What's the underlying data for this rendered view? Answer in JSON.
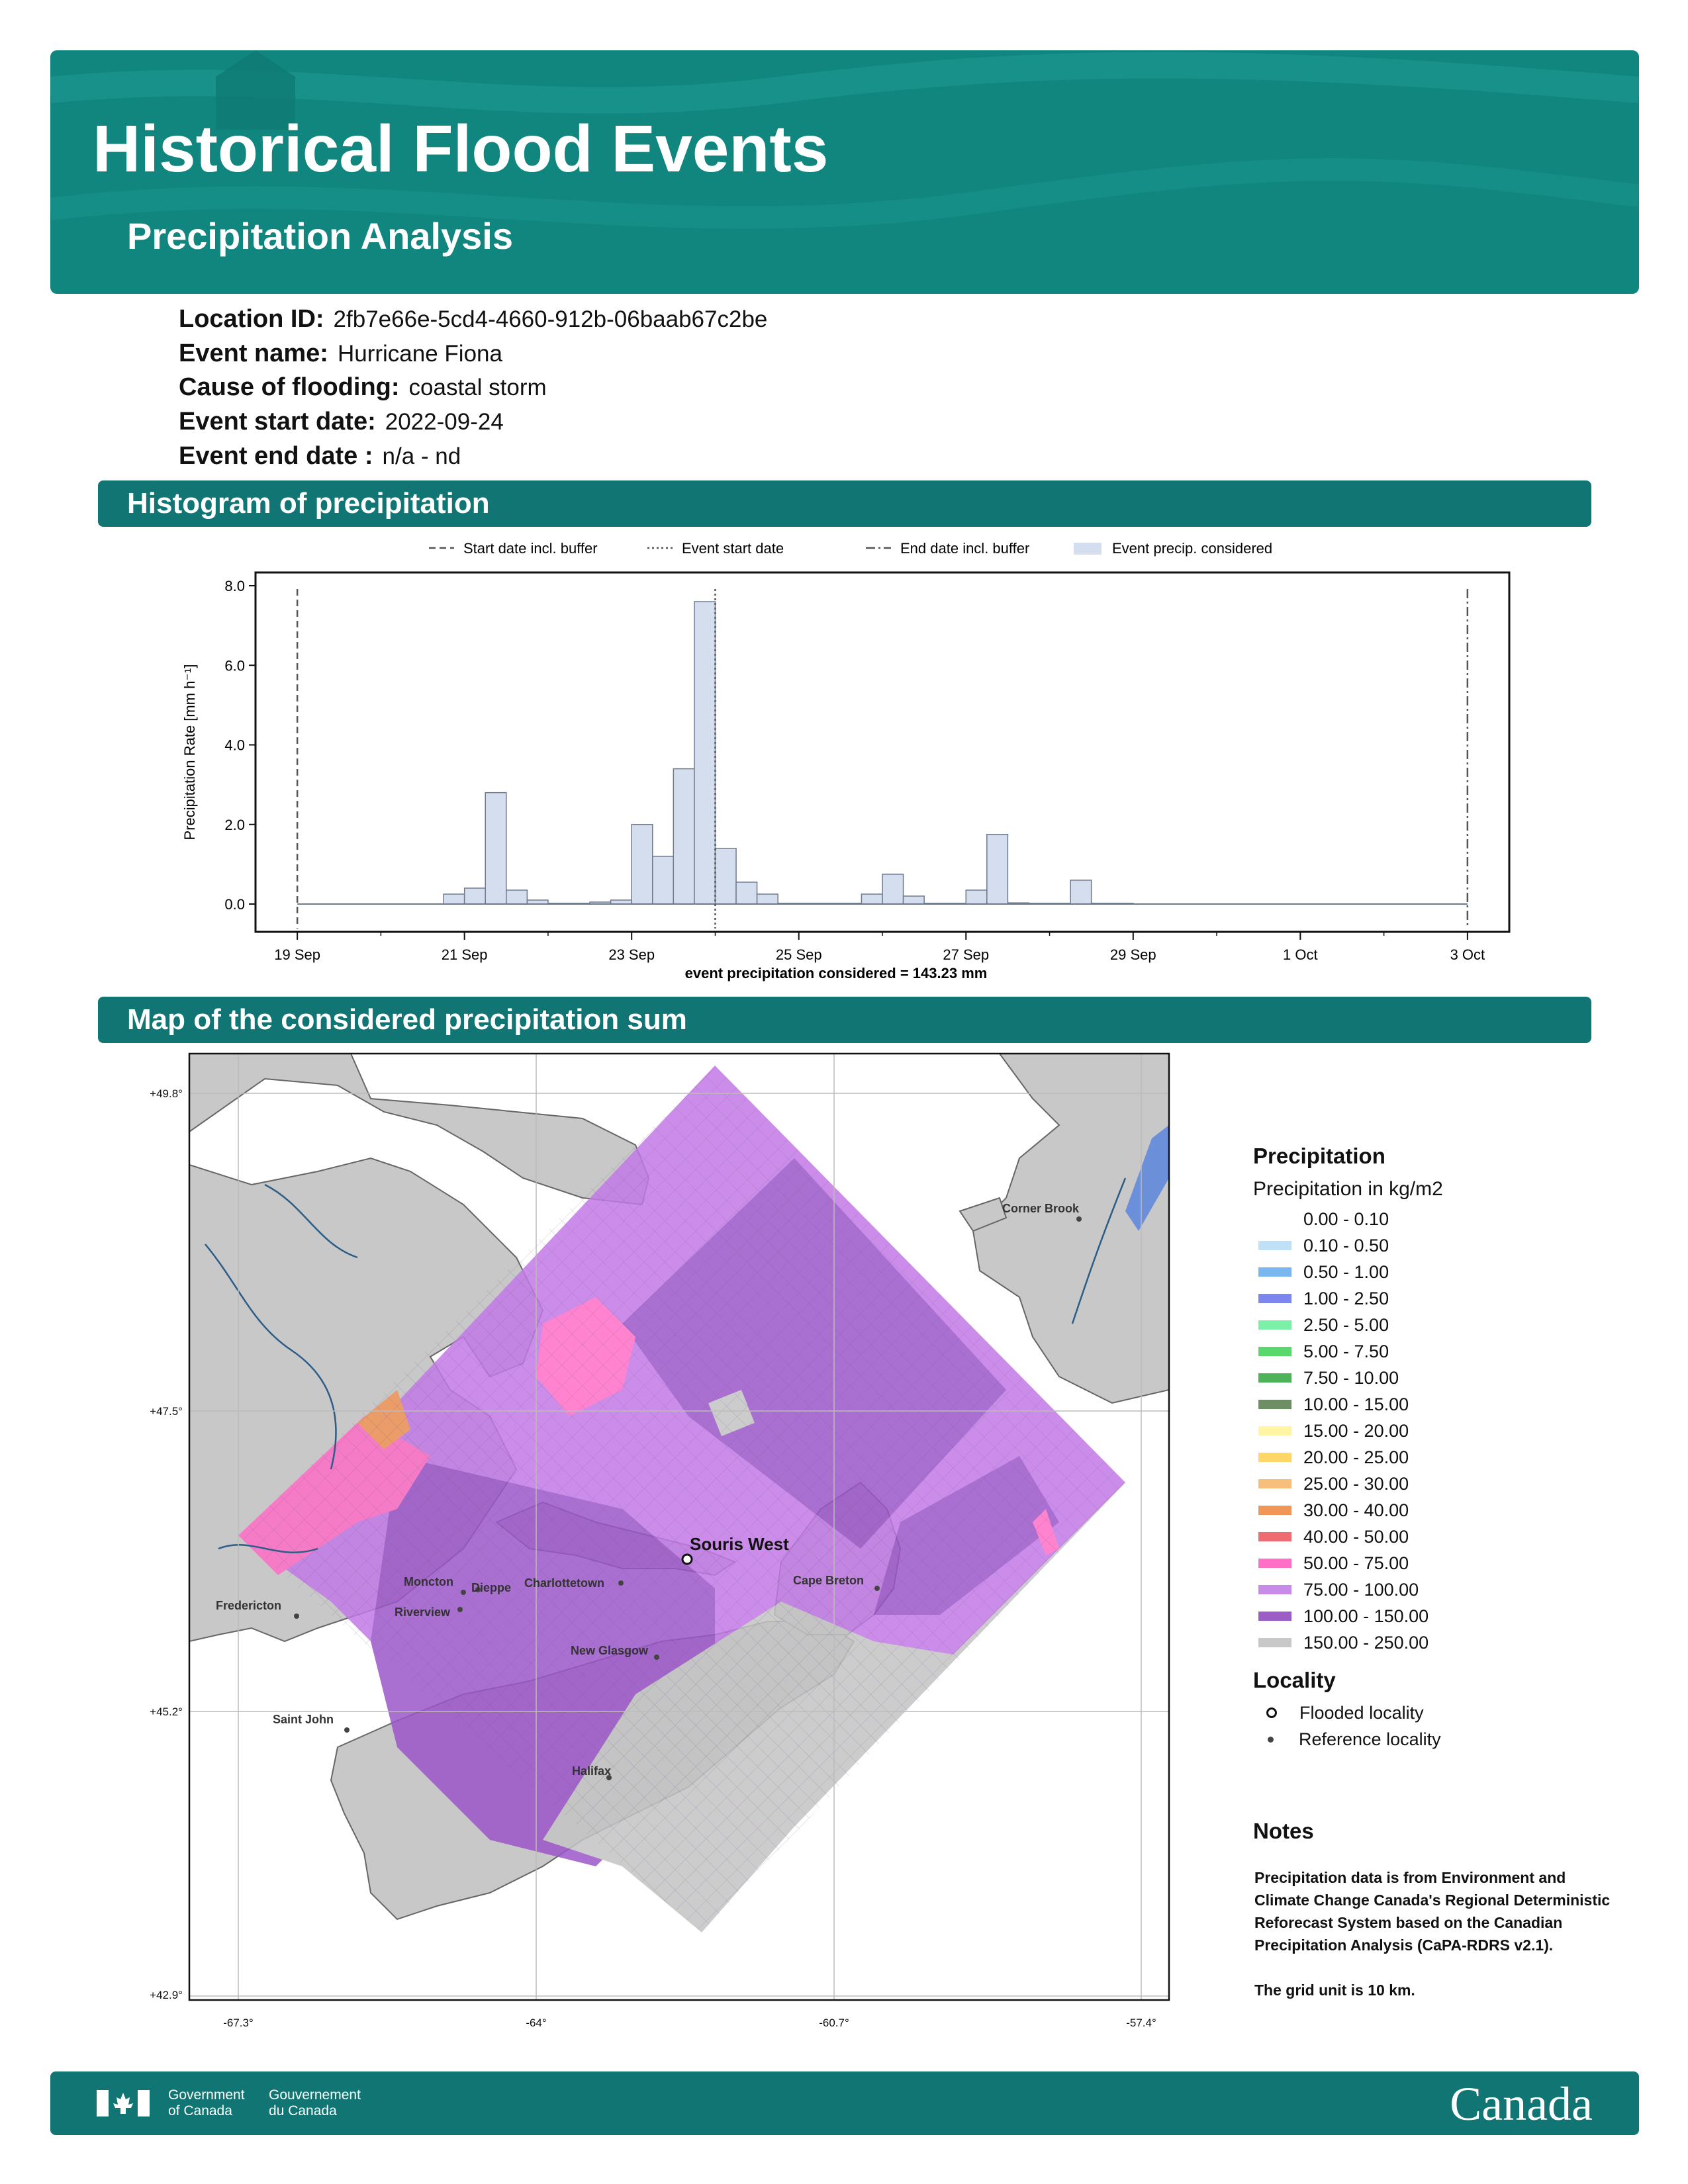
{
  "header": {
    "title": "Historical Flood Events",
    "subtitle": "Precipitation Analysis"
  },
  "meta": {
    "location_label": "Location ID:",
    "location_value": "2fb7e66e-5cd4-4660-912b-06baab67c2be",
    "event_name_label": "Event name:",
    "event_name_value": "Hurricane Fiona",
    "cause_label": "Cause of flooding:",
    "cause_value": "coastal storm",
    "start_label": "Event start date:",
    "start_value": "2022-09-24",
    "end_label": "Event end date :",
    "end_value": "n/a - nd"
  },
  "sections": {
    "histogram": "Histogram of precipitation",
    "map": "Map of the considered precipitation sum"
  },
  "chart_data": {
    "type": "bar",
    "title": "",
    "ylabel": "Precipitation Rate [mm h⁻¹]",
    "xlabel": "event precipitation considered = 143.23 mm",
    "ylim": [
      0,
      8.0
    ],
    "yticks": [
      "0.0",
      "2.0",
      "4.0",
      "6.0",
      "8.0"
    ],
    "xticks": [
      "19 Sep",
      "21 Sep",
      "23 Sep",
      "25 Sep",
      "27 Sep",
      "29 Sep",
      "1 Oct",
      "3 Oct"
    ],
    "bar_width_hours": 6,
    "legend": {
      "placement": "top",
      "entries": [
        "Start date incl. buffer",
        "Event start date",
        "End date incl. buffer",
        "Event precip. considered"
      ]
    },
    "markers": {
      "start_buffer": "2022-09-19T00:00",
      "event_start": "2022-09-24T00:00",
      "end_buffer": "2022-10-03T00:00"
    },
    "series": [
      {
        "name": "Event precip. considered",
        "x": [
          "2022-09-20T18:00",
          "2022-09-21T00:00",
          "2022-09-21T06:00",
          "2022-09-21T12:00",
          "2022-09-21T18:00",
          "2022-09-22T00:00",
          "2022-09-22T06:00",
          "2022-09-22T12:00",
          "2022-09-22T18:00",
          "2022-09-23T00:00",
          "2022-09-23T06:00",
          "2022-09-23T12:00",
          "2022-09-23T18:00",
          "2022-09-24T00:00",
          "2022-09-24T06:00",
          "2022-09-24T12:00",
          "2022-09-24T18:00",
          "2022-09-25T00:00",
          "2022-09-25T06:00",
          "2022-09-25T12:00",
          "2022-09-25T18:00",
          "2022-09-26T00:00",
          "2022-09-26T06:00",
          "2022-09-26T12:00",
          "2022-09-26T18:00",
          "2022-09-27T00:00",
          "2022-09-27T06:00",
          "2022-09-27T12:00",
          "2022-09-27T18:00",
          "2022-09-28T00:00",
          "2022-09-28T06:00",
          "2022-09-28T12:00",
          "2022-09-28T18:00"
        ],
        "values": [
          0.25,
          0.4,
          2.8,
          0.35,
          0.1,
          0.02,
          0.02,
          0.05,
          0.1,
          2.0,
          1.2,
          3.4,
          7.6,
          1.4,
          0.55,
          0.25,
          0.02,
          0.02,
          0.02,
          0.02,
          0.25,
          0.75,
          0.2,
          0.02,
          0.02,
          0.35,
          1.75,
          0.03,
          0.02,
          0.02,
          0.6,
          0.02,
          0.02
        ]
      }
    ]
  },
  "map": {
    "lat_labels": [
      "+49.8°",
      "+47.5°",
      "+45.2°",
      "+42.9°"
    ],
    "lon_labels": [
      "-67.3°",
      "-64°",
      "-60.7°",
      "-57.4°"
    ],
    "localities": {
      "flooded": "Souris West",
      "reference": [
        "Corner Brook",
        "Moncton",
        "Dieppe",
        "Charlottetown",
        "Fredericton",
        "Riverview",
        "Cape Breton",
        "New Glasgow",
        "Saint John",
        "Halifax"
      ]
    },
    "colors": {
      "land": "#c8c8c8",
      "purple_light": "#c27ae6",
      "purple_dark": "#9b56c9",
      "pink": "#ff6ec7",
      "grey_grid": "#c4c4c4"
    }
  },
  "legend": {
    "title": "Precipitation",
    "subtitle": "Precipitation in kg/m2",
    "classes": [
      {
        "label": "0.00 - 0.10",
        "color": "#ffffff"
      },
      {
        "label": "0.10 - 0.50",
        "color": "#bfe0f6"
      },
      {
        "label": "0.50 - 1.00",
        "color": "#7ab7f0"
      },
      {
        "label": "1.00 - 2.50",
        "color": "#7d86ec"
      },
      {
        "label": "2.50 - 5.00",
        "color": "#7cf0a8"
      },
      {
        "label": "5.00 - 7.50",
        "color": "#59d86e"
      },
      {
        "label": "7.50 - 10.00",
        "color": "#4cb35a"
      },
      {
        "label": "10.00 - 15.00",
        "color": "#6e8f64"
      },
      {
        "label": "15.00 - 20.00",
        "color": "#fff5a3"
      },
      {
        "label": "20.00 - 25.00",
        "color": "#ffd766"
      },
      {
        "label": "25.00 - 30.00",
        "color": "#f6c07c"
      },
      {
        "label": "30.00 - 40.00",
        "color": "#f19659"
      },
      {
        "label": "40.00 - 50.00",
        "color": "#ef6b72"
      },
      {
        "label": "50.00 - 75.00",
        "color": "#ff6ec7"
      },
      {
        "label": "75.00 - 100.00",
        "color": "#c98be8"
      },
      {
        "label": "100.00 - 150.00",
        "color": "#9b5ec5"
      },
      {
        "label": "150.00 - 250.00",
        "color": "#c8c8c8"
      }
    ],
    "locality_title": "Locality",
    "flooded_label": "Flooded locality",
    "reference_label": "Reference locality",
    "notes_title": "Notes",
    "notes_text": "Precipitation data is from Environment and Climate Change Canada's Regional Deterministic Reforecast System based on the Canadian Precipitation Analysis (CaPA-RDRS v2.1).",
    "notes_grid": "The grid unit is 10 km."
  },
  "footer": {
    "gov_en": "Government\nof Canada",
    "gov_fr": "Gouvernement\ndu Canada",
    "wordmark": "Canada"
  }
}
